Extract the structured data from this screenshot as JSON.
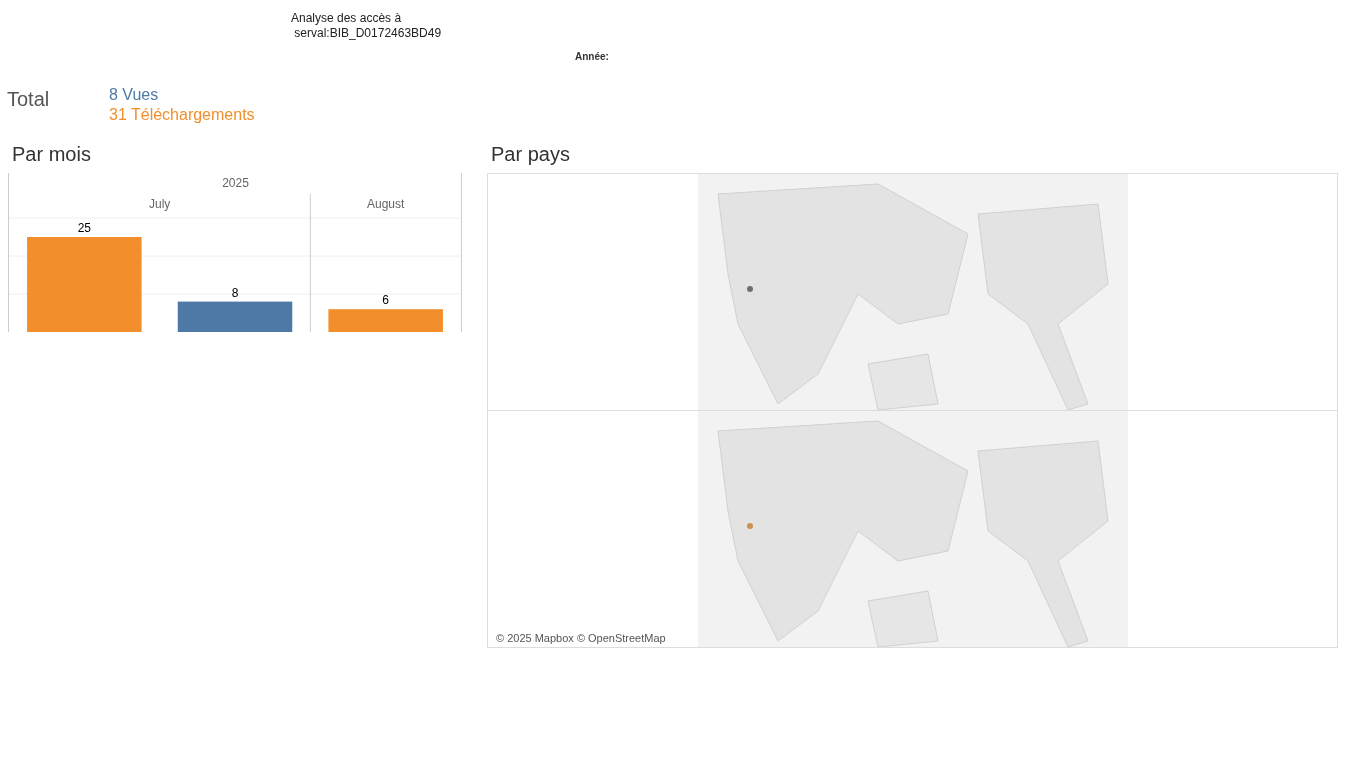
{
  "title": "Analyse des accès à\n serval:BIB_D0172463BD49",
  "year_filter": {
    "label": "Année:"
  },
  "total": {
    "label": "Total",
    "lines": [
      {
        "text": "8 Vues",
        "color": "#4e79a7"
      },
      {
        "text": "31 Téléchargements",
        "color": "#f28e2b"
      }
    ]
  },
  "by_month": {
    "heading": "Par mois",
    "chart_data": {
      "type": "bar",
      "title": "2025",
      "categories": [
        "July",
        "August"
      ],
      "data_labels": true,
      "series": [
        {
          "color": "#f28e2b",
          "values": [
            25,
            6
          ]
        },
        {
          "color": "#4e79a7",
          "values": [
            8,
            null
          ]
        }
      ]
    }
  },
  "by_country": {
    "heading": "Par pays",
    "maps": [
      {
        "color": "#6e6e6e"
      },
      {
        "color": "#c9924f"
      }
    ],
    "attribution": "© 2025 Mapbox © OpenStreetMap"
  }
}
